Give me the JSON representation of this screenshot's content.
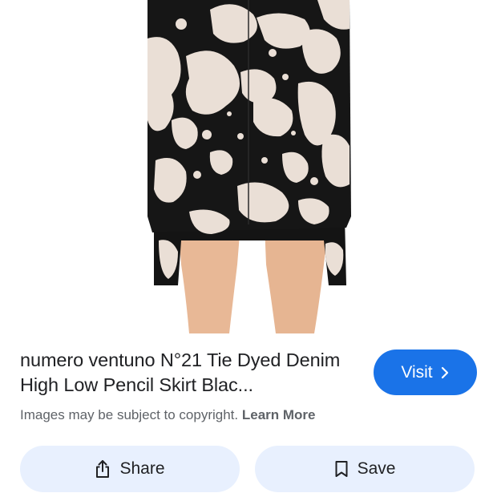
{
  "result": {
    "title": "numero ventuno N°21 Tie Dyed Denim High Low Pencil Skirt Blac...",
    "visit_label": "Visit",
    "copyright_text": "Images may be subject to copyright.",
    "learn_more_label": "Learn More"
  },
  "actions": {
    "share_label": "Share",
    "save_label": "Save"
  },
  "icons": {
    "visit": "chevron-right-icon",
    "share": "share-icon",
    "save": "bookmark-icon"
  },
  "colors": {
    "accent": "#1a73e8",
    "button_bg": "#e8f0fe",
    "text_primary": "#202124",
    "text_secondary": "#5f6368"
  }
}
